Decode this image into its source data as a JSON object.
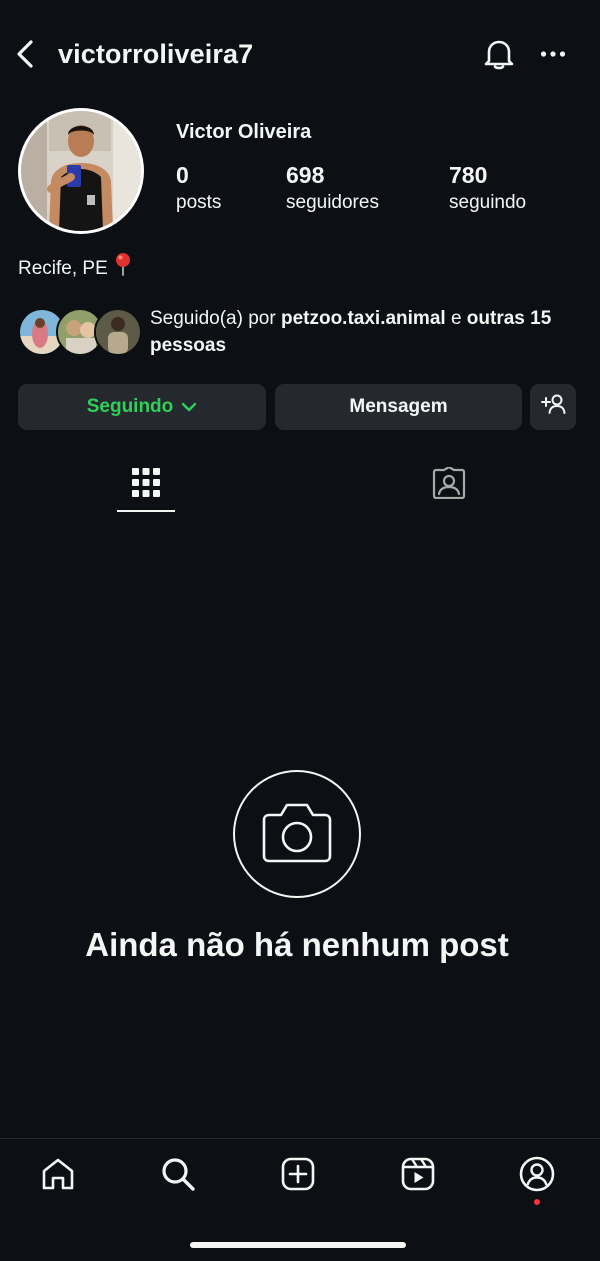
{
  "header": {
    "username": "victorroliveira7",
    "back_icon": "chevron-left-icon",
    "bell_icon": "bell-icon",
    "more_icon": "more-horizontal-icon"
  },
  "profile": {
    "full_name": "Victor Oliveira",
    "location": "Recife, PE",
    "location_icon": "pin-icon",
    "stats": {
      "posts": {
        "count": "0",
        "label": "posts"
      },
      "followers": {
        "count": "698",
        "label": "seguidores"
      },
      "following": {
        "count": "780",
        "label": "seguindo"
      }
    },
    "followed_by": {
      "prefix": "Seguido(a) por ",
      "user": "petzoo.taxi.animal",
      "middle": " e ",
      "others": "outras 15 pessoas"
    }
  },
  "actions": {
    "following_label": "Seguindo",
    "message_label": "Mensagem",
    "suggest_icon": "add-person-icon",
    "following_color": "#2ed158"
  },
  "tabs": {
    "grid_icon": "grid-icon",
    "tagged_icon": "tagged-person-icon",
    "active": "grid"
  },
  "empty_state": {
    "icon": "camera-icon",
    "text": "Ainda não há nenhum post"
  },
  "bottom_nav": {
    "items": [
      "home-icon",
      "search-icon",
      "create-icon",
      "reels-icon",
      "profile-icon"
    ],
    "active": "profile",
    "notification_color": "#ff3040"
  },
  "colors": {
    "background": "#0c1014",
    "button_bg": "#25292e",
    "text": "#f5f5f5"
  }
}
